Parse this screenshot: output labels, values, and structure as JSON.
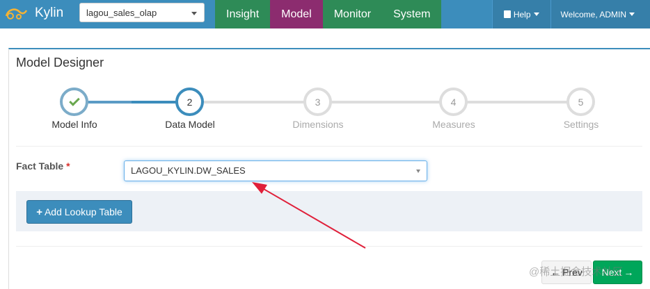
{
  "brand": {
    "name": "Kylin",
    "logo_icon": "kylin-logo-icon"
  },
  "project": {
    "selected": "lagou_sales_olap"
  },
  "nav": {
    "tabs": [
      {
        "label": "Insight",
        "active": false
      },
      {
        "label": "Model",
        "active": true
      },
      {
        "label": "Monitor",
        "active": false
      },
      {
        "label": "System",
        "active": false
      }
    ],
    "help_label": "Help",
    "welcome_label": "Welcome, ADMIN"
  },
  "panel": {
    "title": "Model Designer",
    "steps": [
      {
        "number": "",
        "label": "Model Info",
        "state": "done"
      },
      {
        "number": "2",
        "label": "Data Model",
        "state": "current"
      },
      {
        "number": "3",
        "label": "Dimensions",
        "state": "todo"
      },
      {
        "number": "4",
        "label": "Measures",
        "state": "todo"
      },
      {
        "number": "5",
        "label": "Settings",
        "state": "todo"
      }
    ],
    "fact_table": {
      "label": "Fact Table",
      "required_mark": "*",
      "value": "LAGOU_KYLIN.DW_SALES"
    },
    "add_lookup_label": "Add Lookup Table",
    "prev_label": "Prev",
    "next_label": "Next"
  },
  "colors": {
    "navbar": "#3c8dbc",
    "model_tab_active": "#8c2c6f",
    "tab_green": "#2e8b57",
    "next_button": "#00a65a",
    "annotation_arrow": "#e0203a"
  },
  "watermark": "@稀土掘金技术社区"
}
